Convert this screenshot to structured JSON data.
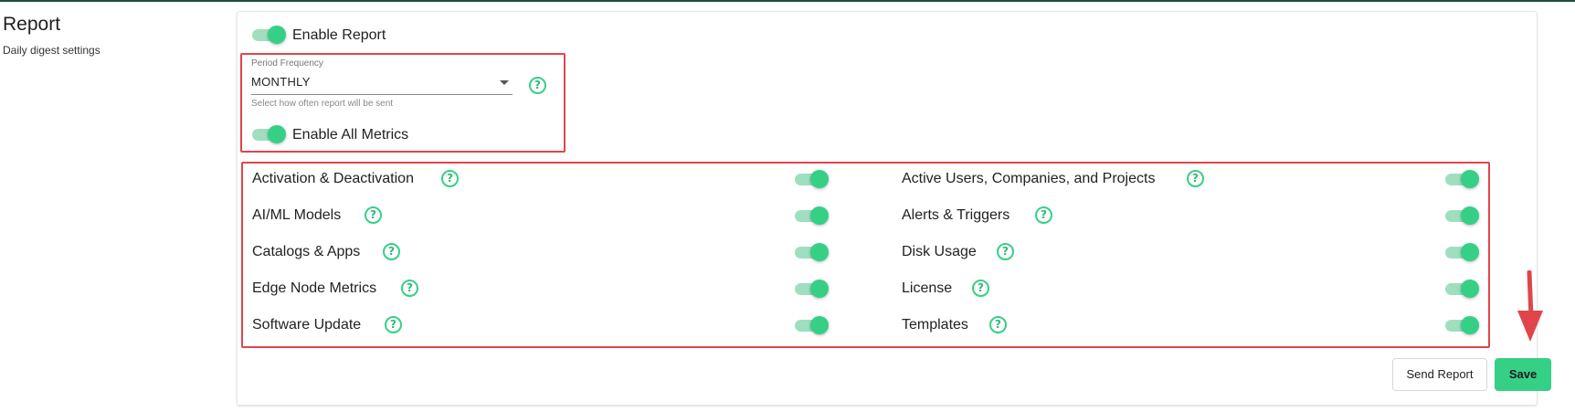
{
  "page": {
    "title": "Report",
    "subtitle": "Daily digest settings"
  },
  "enable_report": {
    "label": "Enable Report",
    "on": true
  },
  "period": {
    "label": "Period Frequency",
    "value": "MONTHLY",
    "hint": "Select how often report will be sent"
  },
  "enable_all": {
    "label": "Enable All Metrics",
    "on": true
  },
  "help_glyph": "?",
  "metrics_left": [
    {
      "label": "Activation & Deactivation",
      "on": true
    },
    {
      "label": "AI/ML Models",
      "on": true
    },
    {
      "label": "Catalogs & Apps",
      "on": true
    },
    {
      "label": "Edge Node Metrics",
      "on": true
    },
    {
      "label": "Software Update",
      "on": true
    }
  ],
  "metrics_right": [
    {
      "label": "Active Users, Companies, and Projects",
      "on": true
    },
    {
      "label": "Alerts & Triggers",
      "on": true
    },
    {
      "label": "Disk Usage",
      "on": true
    },
    {
      "label": "License",
      "on": true
    },
    {
      "label": "Templates",
      "on": true
    }
  ],
  "actions": {
    "send_report": "Send Report",
    "save": "Save"
  },
  "colors": {
    "accent": "#35d086",
    "accent_track": "#9fdfc0",
    "annotation": "#e0454b"
  },
  "icons": {
    "help": "question-circle-icon",
    "caret": "chevron-down-icon",
    "arrow": "arrow-down-annotation"
  }
}
